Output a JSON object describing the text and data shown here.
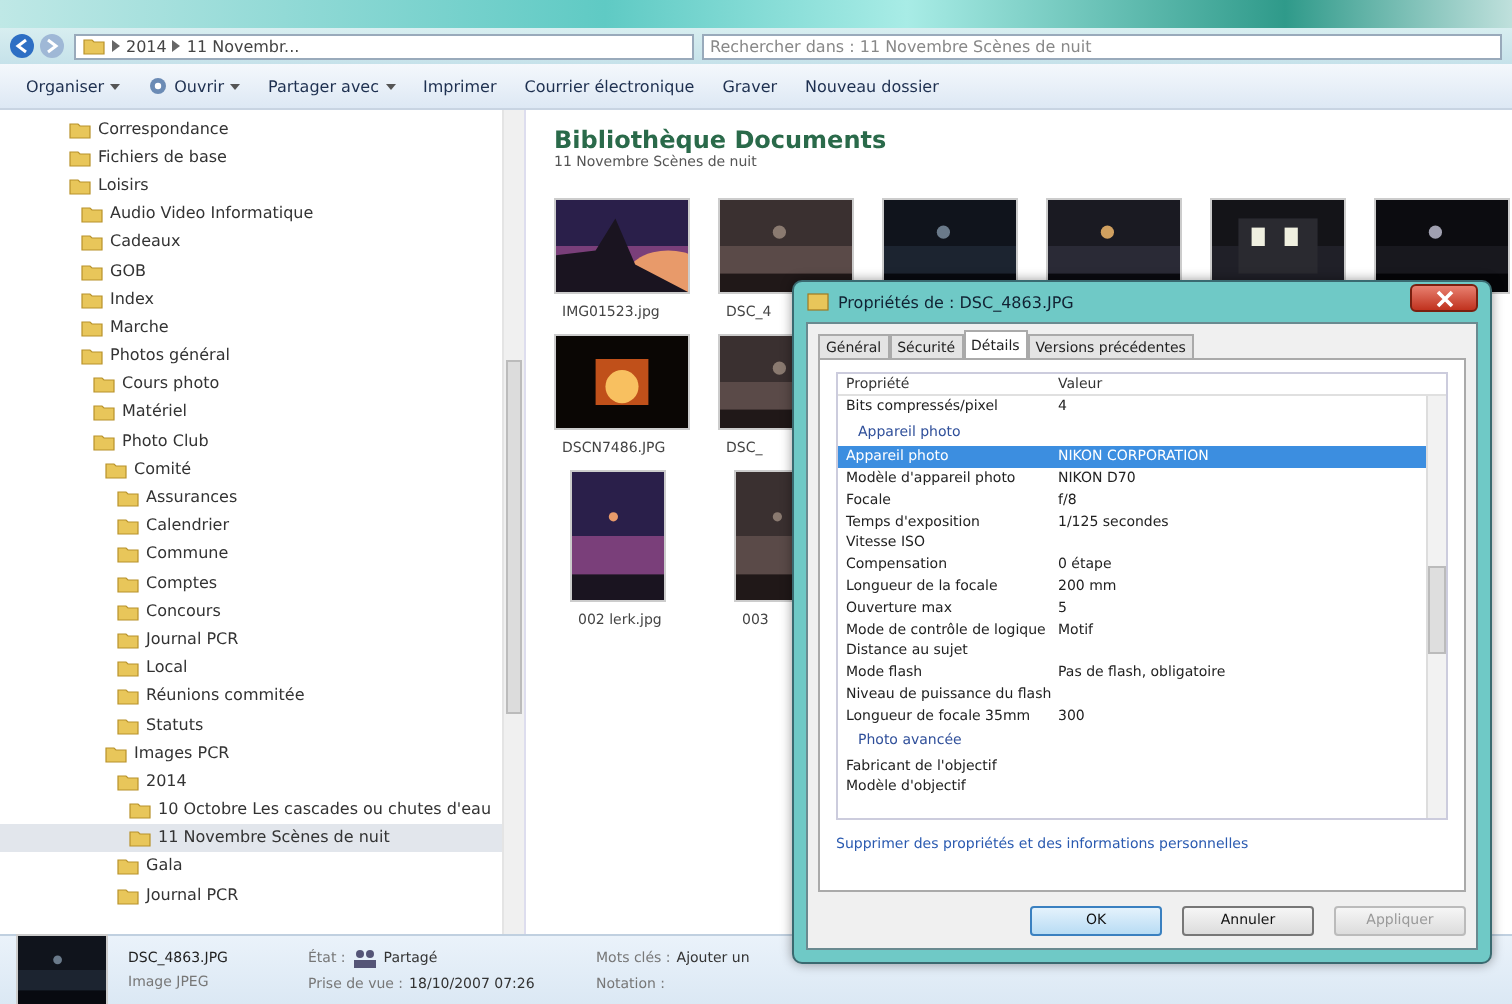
{
  "address_bar": {
    "path": [
      "2014",
      "11 Novembr..."
    ],
    "search_placeholder": "Rechercher dans : 11 Novembre Scènes de nuit"
  },
  "toolbar": [
    {
      "label": "Organiser",
      "menu": true
    },
    {
      "label": "Ouvrir",
      "menu": true
    },
    {
      "label": "Partager avec",
      "menu": true
    },
    {
      "label": "Imprimer",
      "menu": false
    },
    {
      "label": "Courrier électronique",
      "menu": false
    },
    {
      "label": "Graver",
      "menu": false
    },
    {
      "label": "Nouveau dossier",
      "menu": false
    }
  ],
  "tree": [
    {
      "label": "Correspondance",
      "selected": false
    },
    {
      "label": "Fichiers de base",
      "selected": false
    },
    {
      "label": "Loisirs",
      "selected": false,
      "children": [
        {
          "label": "Audio Video Informatique",
          "selected": false
        },
        {
          "label": "Cadeaux",
          "selected": false
        },
        {
          "label": "GOB",
          "selected": false
        },
        {
          "label": "Index",
          "selected": false
        },
        {
          "label": "Marche",
          "selected": false
        },
        {
          "label": "Photos général",
          "selected": false,
          "children": [
            {
              "label": "Cours photo",
              "selected": false
            },
            {
              "label": "Matériel",
              "selected": false
            },
            {
              "label": "Photo Club",
              "selected": false,
              "children": [
                {
                  "label": "Comité",
                  "selected": false,
                  "children": [
                    {
                      "label": "Assurances",
                      "selected": false
                    },
                    {
                      "label": "Calendrier",
                      "selected": false
                    },
                    {
                      "label": "Commune",
                      "selected": false
                    },
                    {
                      "label": "Comptes",
                      "selected": false
                    },
                    {
                      "label": "Concours",
                      "selected": false
                    },
                    {
                      "label": "Journal PCR",
                      "selected": false
                    },
                    {
                      "label": "Local",
                      "selected": false
                    },
                    {
                      "label": "Réunions commitée",
                      "selected": false
                    },
                    {
                      "label": "Statuts",
                      "selected": false
                    }
                  ]
                },
                {
                  "label": "Images PCR",
                  "selected": false,
                  "children": [
                    {
                      "label": "2014",
                      "selected": false,
                      "children": [
                        {
                          "label": "10 Octobre Les cascades ou chutes d'eau",
                          "selected": false
                        },
                        {
                          "label": "11 Novembre Scènes de nuit",
                          "selected": true
                        }
                      ]
                    },
                    {
                      "label": "Gala",
                      "selected": false
                    },
                    {
                      "label": "Journal PCR",
                      "selected": false
                    }
                  ]
                }
              ]
            }
          ]
        }
      ]
    }
  ],
  "library": {
    "title": "Bibliothèque Documents",
    "subtitle": "11 Novembre Scènes de nuit",
    "rows": [
      [
        {
          "kind": "picture",
          "label": "IMG01523.jpg"
        },
        {
          "kind": "picture",
          "label": "DSC_4"
        },
        {
          "kind": "picture"
        },
        {
          "kind": "picture"
        },
        {
          "kind": "picture"
        },
        {
          "kind": "picture"
        }
      ],
      [
        {
          "kind": "picture",
          "label": "DSCN7486.JPG"
        },
        {
          "kind": "picture",
          "label": "DSC_"
        }
      ],
      [
        {
          "kind": "picture",
          "label": "002 lerk.jpg"
        },
        {
          "kind": "picture",
          "label": "003"
        }
      ]
    ]
  },
  "details_pane": {
    "file_name": "DSC_4863.JPG",
    "file_type": "Image JPEG",
    "fields": [
      {
        "label": "État :",
        "value": "Partagé",
        "kind": "shared"
      },
      {
        "label": "Prise de vue :",
        "value": "18/10/2007 07:26",
        "kind": "text"
      },
      {
        "label": "Mots clés :",
        "value": "Ajouter un",
        "kind": "text"
      },
      {
        "label": "Notation :",
        "kind": "text"
      }
    ]
  },
  "dialog": {
    "title": "Propriétés de : DSC_4863.JPG",
    "tabs": [
      {
        "label": "Général",
        "selected": false
      },
      {
        "label": "Sécurité",
        "selected": false
      },
      {
        "label": "Détails",
        "selected": true
      },
      {
        "label": "Versions précédentes",
        "selected": false
      }
    ],
    "columns": [
      "Propriété",
      "Valeur"
    ],
    "rows": [
      {
        "kind": "property",
        "name": "Bits compressés/pixel",
        "value": "4",
        "selected": false
      },
      {
        "kind": "group",
        "name": "Appareil photo"
      },
      {
        "kind": "property",
        "name": "Appareil photo",
        "value": "NIKON CORPORATION",
        "selected": true
      },
      {
        "kind": "property",
        "name": "Modèle d'appareil photo",
        "value": "NIKON D70",
        "selected": false
      },
      {
        "kind": "property",
        "name": "Focale",
        "value": "f/8",
        "selected": false
      },
      {
        "kind": "property",
        "name": "Temps d'exposition",
        "value": "1/125 secondes",
        "selected": false
      },
      {
        "kind": "property",
        "name": "Vitesse ISO",
        "selected": false
      },
      {
        "kind": "property",
        "name": "Compensation",
        "value": "0 étape",
        "selected": false
      },
      {
        "kind": "property",
        "name": "Longueur de la focale",
        "value": "200 mm",
        "selected": false
      },
      {
        "kind": "property",
        "name": "Ouverture max",
        "value": "5",
        "selected": false
      },
      {
        "kind": "property",
        "name": "Mode de contrôle de logique",
        "value": "Motif",
        "selected": false
      },
      {
        "kind": "property",
        "name": "Distance au sujet",
        "selected": false
      },
      {
        "kind": "property",
        "name": "Mode flash",
        "value": "Pas de flash, obligatoire",
        "selected": false
      },
      {
        "kind": "property",
        "name": "Niveau de puissance du flash",
        "selected": false
      },
      {
        "kind": "property",
        "name": "Longueur de focale 35mm",
        "value": "300",
        "selected": false
      },
      {
        "kind": "group",
        "name": "Photo avancée"
      },
      {
        "kind": "property",
        "name": "Fabricant de l'objectif",
        "selected": false
      },
      {
        "kind": "property",
        "name": "Modèle d'objectif",
        "selected": false
      }
    ],
    "link": "Supprimer des propriétés et des informations personnelles",
    "buttons": [
      {
        "label": "OK",
        "disabled": false,
        "default": true
      },
      {
        "label": "Annuler",
        "disabled": false,
        "default": false
      },
      {
        "label": "Appliquer",
        "disabled": true,
        "default": false
      }
    ]
  }
}
